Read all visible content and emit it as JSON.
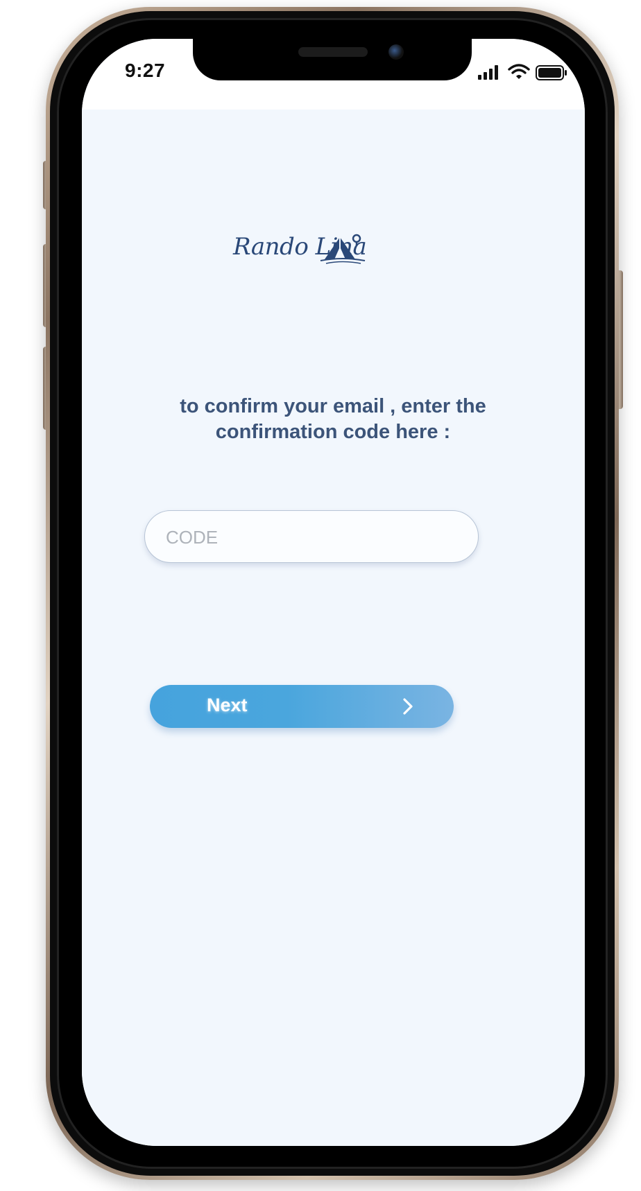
{
  "status_bar": {
    "time": "9:27",
    "icons": [
      "cellular-signal-icon",
      "wifi-icon",
      "battery-icon"
    ]
  },
  "app": {
    "logo_text": "Rando Lina"
  },
  "confirm": {
    "instruction_line1": "to confirm your email , enter the",
    "instruction_line2": "confirmation code here :",
    "code_placeholder": "CODE",
    "code_value": "",
    "next_label": "Next"
  },
  "colors": {
    "background": "#f2f7fd",
    "text": "#3c5479",
    "button_start": "#46a3dd",
    "button_end": "#7ab4e2",
    "logo": "#2a4878"
  }
}
